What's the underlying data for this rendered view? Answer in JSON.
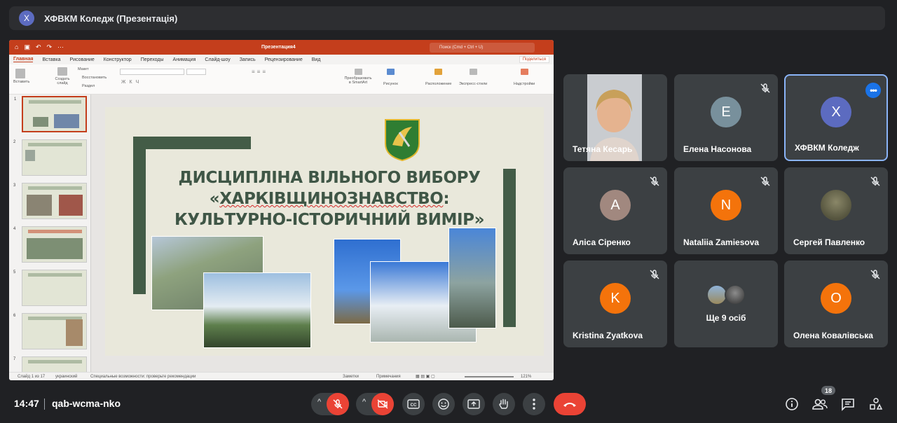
{
  "meeting": {
    "presenter_initial": "Х",
    "presenting_title": "ХФВКМ Коледж (Презентація)",
    "time": "14:47",
    "code": "qab-wcma-nko",
    "people_count": "18"
  },
  "ppt": {
    "doc_name": "Презентация4",
    "search_placeholder": "Поиск (Cmd + Ctrl + U)",
    "tabs": [
      "Главная",
      "Вставка",
      "Рисование",
      "Конструктор",
      "Переходы",
      "Анимация",
      "Слайд-шоу",
      "Запись",
      "Рецензирование",
      "Вид"
    ],
    "share_label": "Поделиться",
    "ribbon": {
      "paste": "Вставить",
      "create_slide": "Создать слайд",
      "layout": "Макет",
      "reset": "Восстановить",
      "section": "Раздел",
      "smartart": "Преобразовать в SmartArt",
      "picture": "Рисунок",
      "arrange": "Расположение",
      "quick_styles": "Экспресс-стили",
      "addins": "Надстройки"
    },
    "slide_numbers": [
      "1",
      "2",
      "3",
      "4",
      "5",
      "6",
      "7"
    ],
    "slide": {
      "line1": "ДИСЦИПЛІНА ВІЛЬНОГО ВИБОРУ",
      "line2_pre": "«",
      "line2_word": "ХАРКІВЩИНОЗНАВСТВО",
      "line2_post": ":",
      "line3": "КУЛЬТУРНО-ІСТОРИЧНИЙ ВИМІР»"
    },
    "status": {
      "slide_of": "Слайд 1 из 17",
      "language": "украинский",
      "accessibility": "Специальные возможности: проверьте рекомендации",
      "notes": "Заметки",
      "comments": "Примечания",
      "zoom": "121%"
    }
  },
  "participants": [
    {
      "name": "Тетяна Кесарь",
      "initial": "",
      "color": "",
      "muted": false,
      "video": true
    },
    {
      "name": "Елена Насонова",
      "initial": "Е",
      "color": "#78909c",
      "muted": true
    },
    {
      "name": "ХФВКМ Коледж",
      "initial": "Х",
      "color": "#5c6bc0",
      "muted": false
    },
    {
      "name": "Аліса Сіренко",
      "initial": "А",
      "color": "#a1887f",
      "muted": true
    },
    {
      "name": "Nataliia Zamiesova",
      "initial": "N",
      "color": "#f4730b",
      "muted": true
    },
    {
      "name": "Сергей Павленко",
      "initial": "",
      "color": "#6b6a55",
      "muted": true
    },
    {
      "name": "Kristina Zyatkova",
      "initial": "K",
      "color": "#f4730b",
      "muted": true
    },
    {
      "name": "Ще 9 осіб",
      "initial": "",
      "color": "",
      "muted": false
    },
    {
      "name": "Олена Ковалівська",
      "initial": "О",
      "color": "#f4730b",
      "muted": true
    }
  ],
  "icons": {
    "mic_off": "mic-off-icon",
    "cam_off": "camera-off-icon",
    "captions": "captions-icon",
    "emoji": "emoji-icon",
    "present": "present-icon",
    "hand": "raise-hand-icon",
    "more": "more-vert-icon",
    "leave": "call-end-icon",
    "info": "info-icon",
    "people": "people-icon",
    "chat": "chat-icon",
    "activities": "activities-icon"
  },
  "colors": {
    "background": "#202124",
    "tile": "#3c4043",
    "accent_red": "#ea4335",
    "ppt_brand": "#c43e1c",
    "slide_green": "#435c47"
  }
}
